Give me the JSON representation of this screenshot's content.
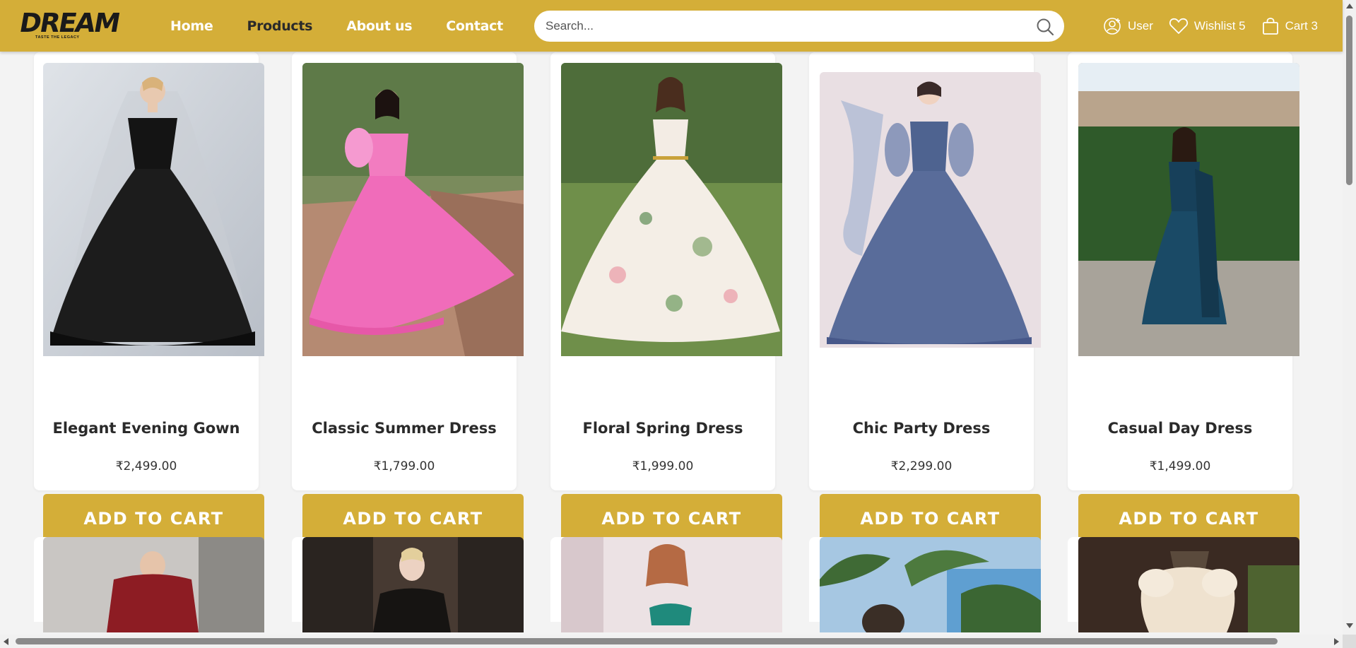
{
  "header": {
    "logo_text": "DREAM",
    "logo_tagline": "TASTE THE LEGACY",
    "nav": [
      "Home",
      "Products",
      "About us",
      "Contact"
    ],
    "search_placeholder": "Search...",
    "user_label": "User",
    "wishlist_label": "Wishlist 5",
    "cart_label": "Cart 3"
  },
  "products": [
    {
      "name": "Elegant Evening Gown",
      "price": "₹2,499.00",
      "button": "ADD TO CART"
    },
    {
      "name": "Classic Summer Dress",
      "price": "₹1,799.00",
      "button": "ADD TO CART"
    },
    {
      "name": "Floral Spring Dress",
      "price": "₹1,999.00",
      "button": "ADD TO CART"
    },
    {
      "name": "Chic Party Dress",
      "price": "₹2,299.00",
      "button": "ADD TO CART"
    },
    {
      "name": "Casual Day Dress",
      "price": "₹1,499.00",
      "button": "ADD TO CART"
    }
  ],
  "colors": {
    "accent": "#d4ae38",
    "page_bg": "#f3f3f3"
  }
}
